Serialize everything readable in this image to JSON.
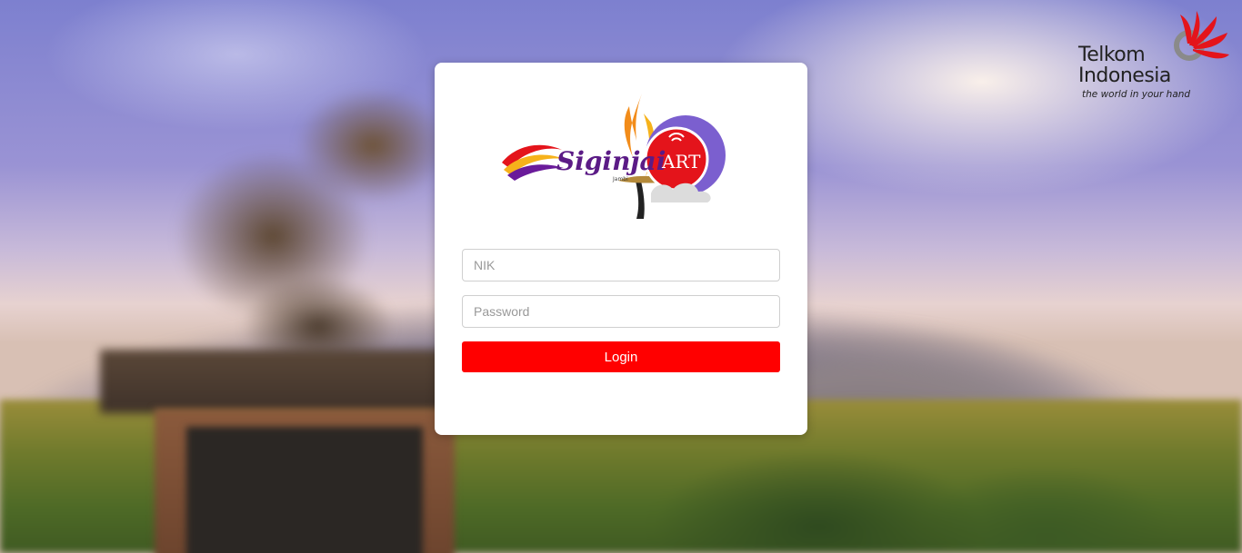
{
  "brand": {
    "logo_text": "Siginjai",
    "logo_subtext": "Jambi",
    "logo_badge": "ART"
  },
  "corporate": {
    "line1": "Telkom",
    "line2": "Indonesia",
    "tagline": "the world in your hand"
  },
  "login": {
    "nik_placeholder": "NIK",
    "nik_value": "",
    "password_placeholder": "Password",
    "password_value": "",
    "button_label": "Login"
  },
  "colors": {
    "accent": "#ff0000",
    "card": "#ffffff"
  },
  "icons": {
    "corporate_symbol": "telkom-symbol-icon",
    "brand_symbol": "flame-keris-icon"
  }
}
